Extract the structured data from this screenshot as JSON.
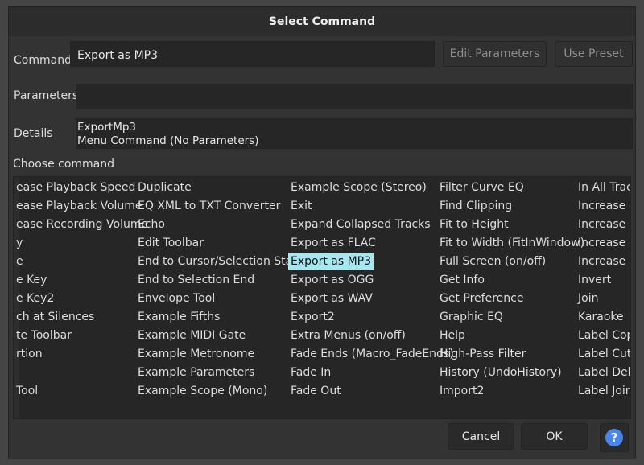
{
  "dialog": {
    "title": "Select Command"
  },
  "command": {
    "label": "Command",
    "value": "Export as MP3",
    "edit_parameters": "Edit Parameters",
    "use_preset": "Use Preset"
  },
  "parameters": {
    "label": "Parameters",
    "value": ""
  },
  "details": {
    "label": "Details",
    "line1": "ExportMp3",
    "line2": "Menu Command (No Parameters)"
  },
  "choose": {
    "label": "Choose command",
    "selected": "Export as MP3",
    "columns": [
      [
        "ease Playback Speed",
        "ease Playback Volume",
        "ease Recording Volume",
        "y",
        "e",
        "e Key",
        "e Key2",
        "ch at Silences",
        "te Toolbar",
        "rtion",
        "",
        " Tool"
      ],
      [
        "Duplicate",
        "EQ XML to TXT Converter",
        "Echo",
        "Edit Toolbar",
        "End to Cursor/Selection Start",
        "End to Selection End",
        "Envelope Tool",
        "Example Fifths",
        "Example MIDI Gate",
        "Example Metronome",
        "Example Parameters",
        "Example Scope (Mono)"
      ],
      [
        "Example Scope (Stereo)",
        "Exit",
        "Expand Collapsed Tracks",
        "Export as FLAC",
        "Export as MP3",
        "Export as OGG",
        "Export as WAV",
        "Export2",
        "Extra Menus (on/off)",
        "Fade Ends (Macro_FadeEnds)",
        "Fade In",
        "Fade Out"
      ],
      [
        "Filter Curve EQ",
        "Find Clipping",
        "Fit to Height",
        "Fit to Width (FitInWindow)",
        "Full Screen (on/off)",
        "Get Info",
        "Get Preference",
        "Graphic EQ",
        "Help",
        "High-Pass Filter",
        "History (UndoHistory)",
        "Import2"
      ],
      [
        "In All Tracks",
        "Increase Ga",
        "Increase Pl",
        "Increase Pl",
        "Increase Re",
        "Invert",
        "Join",
        "Karaoke",
        "Label Copy",
        "Label Cut (",
        "Label Dele",
        "Label Join"
      ]
    ]
  },
  "footer": {
    "cancel": "Cancel",
    "ok": "OK",
    "help_glyph": "?"
  },
  "colors": {
    "selection": "#a6e7f0",
    "help": "#4a86e8"
  }
}
